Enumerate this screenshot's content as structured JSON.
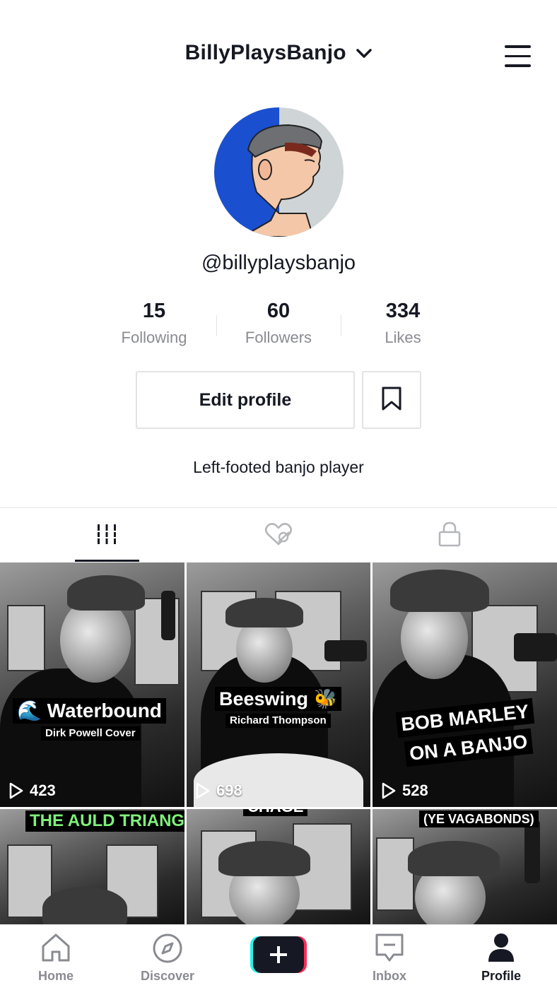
{
  "header": {
    "title": "BillyPlaysBanjo"
  },
  "profile": {
    "handle": "@billyplaysbanjo",
    "bio": "Left-footed banjo player",
    "stats": [
      {
        "value": "15",
        "label": "Following"
      },
      {
        "value": "60",
        "label": "Followers"
      },
      {
        "value": "334",
        "label": "Likes"
      }
    ],
    "edit_label": "Edit profile"
  },
  "videos": [
    {
      "title": "🌊 Waterbound",
      "subtitle": "Dirk Powell Cover",
      "views": "423"
    },
    {
      "title": "Beeswing 🐝",
      "subtitle": "Richard Thompson",
      "views": "698"
    },
    {
      "title": "BOB MARLEY",
      "title2": "ON A BANJO",
      "views": "528"
    },
    {
      "title": "THE AULD TRIANGLE"
    },
    {
      "title": "CHAGE"
    },
    {
      "title": "(YE VAGABONDS)"
    }
  ],
  "nav": {
    "items": [
      {
        "label": "Home"
      },
      {
        "label": "Discover"
      },
      {
        "label": "Inbox"
      },
      {
        "label": "Profile"
      }
    ]
  },
  "colors": {
    "text": "#161823",
    "muted": "#8a8b91",
    "accent_cyan": "#25f4ee",
    "accent_red": "#fe2c55"
  }
}
